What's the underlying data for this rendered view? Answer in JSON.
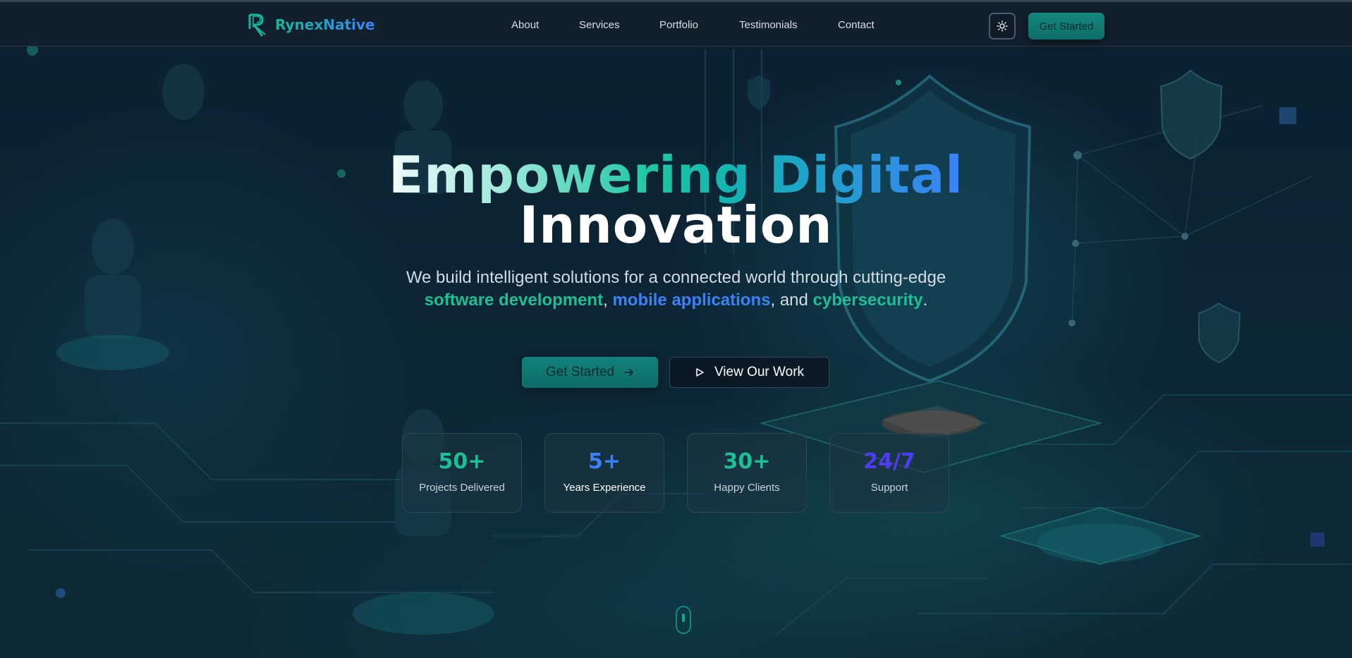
{
  "brand": {
    "name": "RynexNative",
    "logo_icon": "r-logo-icon",
    "gradient_start": "#19b79a",
    "gradient_end": "#3b82f6"
  },
  "nav": {
    "links": [
      "About",
      "Services",
      "Portfolio",
      "Testimonials",
      "Contact"
    ],
    "theme_toggle_icon": "sun-icon",
    "cta_label": "Get Started"
  },
  "hero": {
    "title_line1": "Empowering Digital",
    "title_line2": "Innovation",
    "subtitle": {
      "before": "We build intelligent solutions for a connected world through cutting-edge ",
      "highlight1": "software development",
      "between1": ", ",
      "highlight2": "mobile applications",
      "between2": ", and ",
      "highlight3": "cybersecurity",
      "end": "."
    },
    "primary_cta": {
      "label": "Get Started",
      "icon": "arrow-right-icon"
    },
    "secondary_cta": {
      "label": "View Our Work",
      "icon": "play-icon"
    }
  },
  "stats": [
    {
      "value": "50+",
      "label": "Projects Delivered",
      "color": "#1fbf96"
    },
    {
      "value": "5+",
      "label": "Years Experience",
      "color": "#3b82f6"
    },
    {
      "value": "30+",
      "label": "Happy Clients",
      "color": "#1fbf96"
    },
    {
      "value": "24/7",
      "label": "Support",
      "color": "#4f3cf0"
    }
  ],
  "scroll_indicator_icon": "mouse-scroll-icon",
  "colors": {
    "accent_teal": "#1fbf96",
    "accent_blue": "#3b82f6",
    "button_teal": "#12837c",
    "background": "#0b1d2b"
  }
}
